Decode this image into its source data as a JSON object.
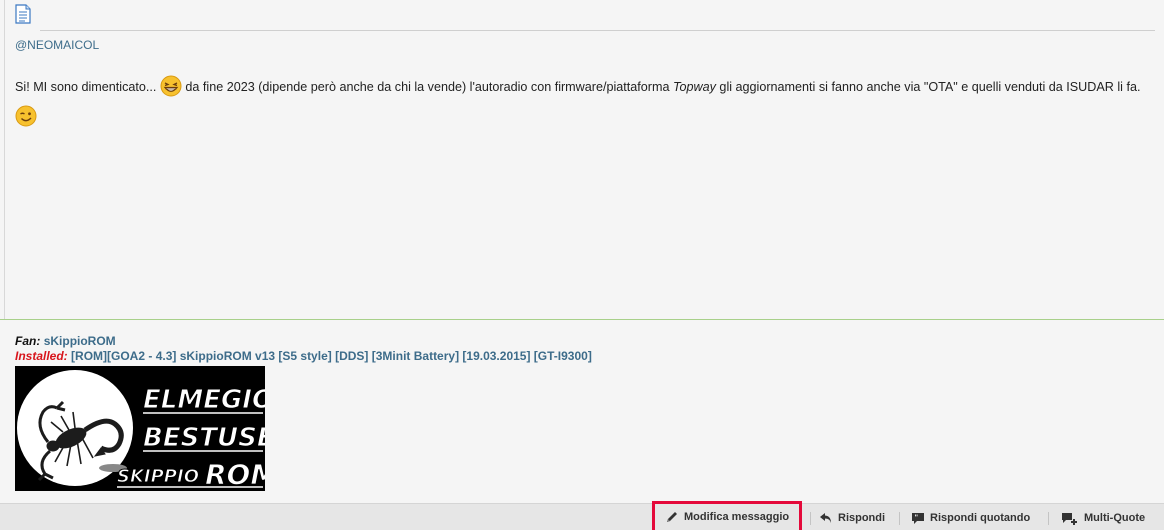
{
  "post": {
    "mention": "@NEOMAICOL",
    "msg_part1": "Si! MI sono dimenticato...",
    "msg_part2": " da fine 2023 (dipende però anche da chi la vende) l'autoradio con firmware/piattaforma ",
    "msg_italic": "Topway",
    "msg_part3": " gli aggiornamenti si fanno anche via \"OTA\" e quelli venduti da ISUDAR li fa.",
    "emoji1": "laughing-emoji",
    "emoji2": "wink-emoji"
  },
  "signature": {
    "fan_label": "Fan:",
    "fan_value": "sKippioROM",
    "installed_label": "Installed:",
    "installed_value": "[ROM][GOA2 - 4.3] sKippioROM v13 [S5 style] [DDS] [3Minit Battery] [19.03.2015] [GT-I9300]",
    "banner_line1": "ELMEGIO",
    "banner_line2": "BESTUSER",
    "banner_line3_a": "SKIPPIO",
    "banner_line3_b": "ROM"
  },
  "actions": {
    "edit": "Modifica messaggio",
    "reply": "Rispondi",
    "quote": "Rispondi quotando",
    "multi": "Multi-Quote"
  },
  "colors": {
    "link": "#3d6c8a",
    "highlight": "#e4093a",
    "installed": "#d8141b"
  }
}
